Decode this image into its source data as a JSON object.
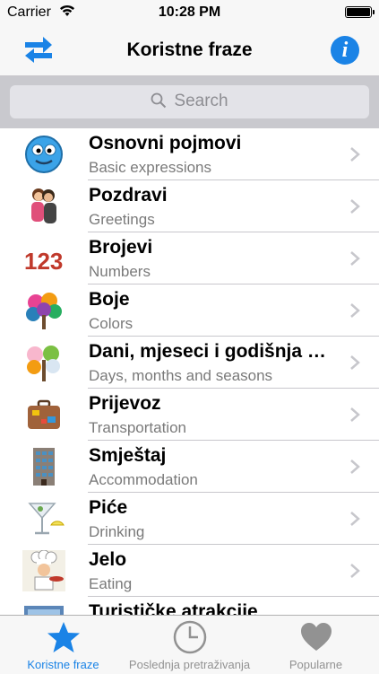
{
  "status_bar": {
    "carrier": "Carrier",
    "time": "10:28 PM"
  },
  "nav": {
    "title": "Koristne fraze",
    "info_glyph": "i"
  },
  "search": {
    "placeholder": "Search"
  },
  "rows": [
    {
      "title": "Osnovni pojmovi",
      "subtitle": "Basic expressions",
      "icon": "smiley-face-icon"
    },
    {
      "title": "Pozdravi",
      "subtitle": "Greetings",
      "icon": "hugging-people-icon"
    },
    {
      "title": "Brojevi",
      "subtitle": "Numbers",
      "icon": "numbers-123-icon",
      "icon_text": "123"
    },
    {
      "title": "Boje",
      "subtitle": "Colors",
      "icon": "colorful-tree-icon"
    },
    {
      "title": "Dani, mjeseci i godišnja doba",
      "subtitle": "Days, months and seasons",
      "icon": "seasons-tree-icon"
    },
    {
      "title": "Prijevoz",
      "subtitle": "Transportation",
      "icon": "suitcase-icon"
    },
    {
      "title": "Smještaj",
      "subtitle": "Accommodation",
      "icon": "hotel-building-icon"
    },
    {
      "title": "Piće",
      "subtitle": "Drinking",
      "icon": "cocktail-icon"
    },
    {
      "title": "Jelo",
      "subtitle": "Eating",
      "icon": "chef-icon"
    },
    {
      "title": "Turističke atrakcije",
      "subtitle": "",
      "icon": "attraction-icon"
    }
  ],
  "tabs": [
    {
      "label": "Koristne fraze",
      "icon": "star-icon",
      "active": true
    },
    {
      "label": "Poslednja pretraživanja",
      "icon": "clock-icon",
      "active": false
    },
    {
      "label": "Popularne",
      "icon": "heart-icon",
      "active": false
    }
  ],
  "colors": {
    "accent": "#1a83e6",
    "inactive": "#929292"
  }
}
